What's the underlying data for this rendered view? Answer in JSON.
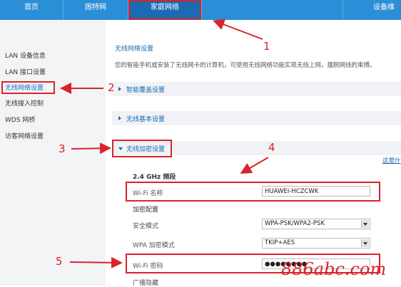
{
  "topnav": {
    "items": [
      {
        "label": "首页"
      },
      {
        "label": "困特网"
      },
      {
        "label": "家庭网络"
      },
      {
        "label": "设备维"
      }
    ]
  },
  "sidebar": {
    "items": [
      {
        "label": "LAN 设备信息"
      },
      {
        "label": "LAN 接口设置"
      },
      {
        "label": "无线网络设置"
      },
      {
        "label": "无线接入控制"
      },
      {
        "label": "WDS 网桥"
      },
      {
        "label": "访客网络设置"
      }
    ]
  },
  "content": {
    "title": "无线网络设置",
    "description": "您的智能手机或安装了无线网卡的计算机，可使用无线网络功能实现无线上网，摆脱网线的束缚。",
    "sections": [
      {
        "label": "智能覆盖设置"
      },
      {
        "label": "无线基本设置"
      },
      {
        "label": "无线加密设置"
      }
    ],
    "right_link": "这是什",
    "band_label": "2.4 GHz 频段",
    "wifi_name": {
      "label": "Wi-Fi 名称",
      "value": "HUAWEI-HCZCWK"
    },
    "encryption_heading": "加密配置",
    "security_mode": {
      "label": "安全模式",
      "value": "WPA-PSK/WPA2-PSK"
    },
    "wpa_mode": {
      "label": "WPA 加密模式",
      "value": "TKIP+AES"
    },
    "wifi_password": {
      "label": "Wi-Fi 密码",
      "value": "●●●●●●●●"
    },
    "broadcast_label": "广播隐藏"
  },
  "annotations": [
    "1",
    "2",
    "3",
    "4",
    "5"
  ],
  "watermark": "886abc.com",
  "colors": {
    "nav": "#2a8fd6",
    "nav_active": "#1a6bb3",
    "highlight": "#d9232a"
  }
}
